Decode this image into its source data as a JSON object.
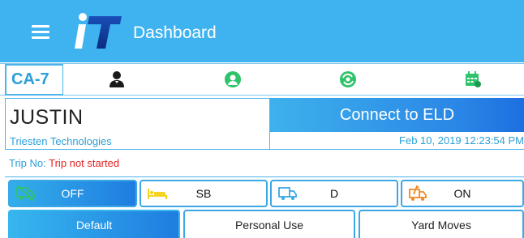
{
  "header": {
    "title": "Dashboard",
    "logo_text": "iT",
    "brand_color": "#3fb3ef"
  },
  "icon_row": {
    "vehicle_id": "CA-7",
    "icons": [
      "driver-icon",
      "co-driver-icon",
      "sync-icon",
      "calendar-icon"
    ]
  },
  "driver": {
    "name": "JUSTIN",
    "company": "Triesten Technologies"
  },
  "eld": {
    "connect_label": "Connect to ELD",
    "datetime": "Feb 10, 2019 12:23:54 PM"
  },
  "trip": {
    "label": "Trip No:",
    "status": "Trip not started"
  },
  "duty_status": [
    {
      "label": "OFF",
      "icon": "truck-off-icon",
      "active": true
    },
    {
      "label": "SB",
      "icon": "sleeper-bed-icon",
      "active": false
    },
    {
      "label": "D",
      "icon": "truck-driving-icon",
      "active": false
    },
    {
      "label": "ON",
      "icon": "truck-on-duty-icon",
      "active": false
    }
  ],
  "modes": [
    {
      "label": "Default",
      "active": true
    },
    {
      "label": "Personal Use",
      "active": false
    },
    {
      "label": "Yard Moves",
      "active": false
    }
  ],
  "colors": {
    "accent": "#2a9fd9",
    "error": "#e52222",
    "green_icon": "#2fc36a",
    "yellow_icon": "#f5d320",
    "orange_icon": "#f08a24"
  }
}
